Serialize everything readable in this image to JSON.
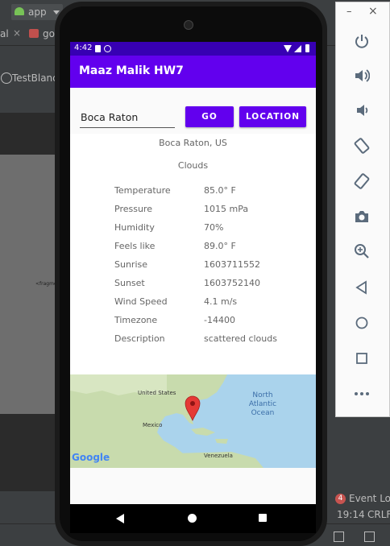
{
  "ide": {
    "run_config": "app",
    "tab_left": "al",
    "tab_go": "go",
    "breadcrumb": "TestBlanck",
    "fragment_label": "<fragme",
    "event_log": "Event Log",
    "event_count": "4",
    "cursor_pos": "19:14",
    "line_ending": "CRLF"
  },
  "emulator": {
    "minimize": "–",
    "close": "×",
    "controls": [
      "power-icon",
      "volume-up-icon",
      "volume-down-icon",
      "rotate-left-icon",
      "rotate-right-icon",
      "camera-icon",
      "zoom-icon",
      "back-icon",
      "home-icon",
      "overview-icon",
      "more-icon"
    ]
  },
  "device": {
    "time": "4:42"
  },
  "app": {
    "title": "Maaz Malik HW7",
    "city_input": "Boca Raton",
    "go_button": "GO",
    "location_button": "LOCATION",
    "city_country": "Boca Raton, US",
    "main_weather": "Clouds",
    "details": [
      {
        "label": "Temperature",
        "value": "85.0° F"
      },
      {
        "label": "Pressure",
        "value": "1015 mPa"
      },
      {
        "label": "Humidity",
        "value": "70%"
      },
      {
        "label": "Feels like",
        "value": "89.0° F"
      },
      {
        "label": "Sunrise",
        "value": "1603711552"
      },
      {
        "label": "Sunset",
        "value": "1603752140"
      },
      {
        "label": "Wind Speed",
        "value": "4.1 m/s"
      },
      {
        "label": "Timezone",
        "value": "-14400"
      },
      {
        "label": "Description",
        "value": "scattered clouds"
      }
    ]
  },
  "map": {
    "united_states": "United States",
    "mexico": "Mexico",
    "venezuela": "Venezuela",
    "ocean_line1": "North",
    "ocean_line2": "Atlantic",
    "ocean_line3": "Ocean",
    "brand": "Google"
  }
}
